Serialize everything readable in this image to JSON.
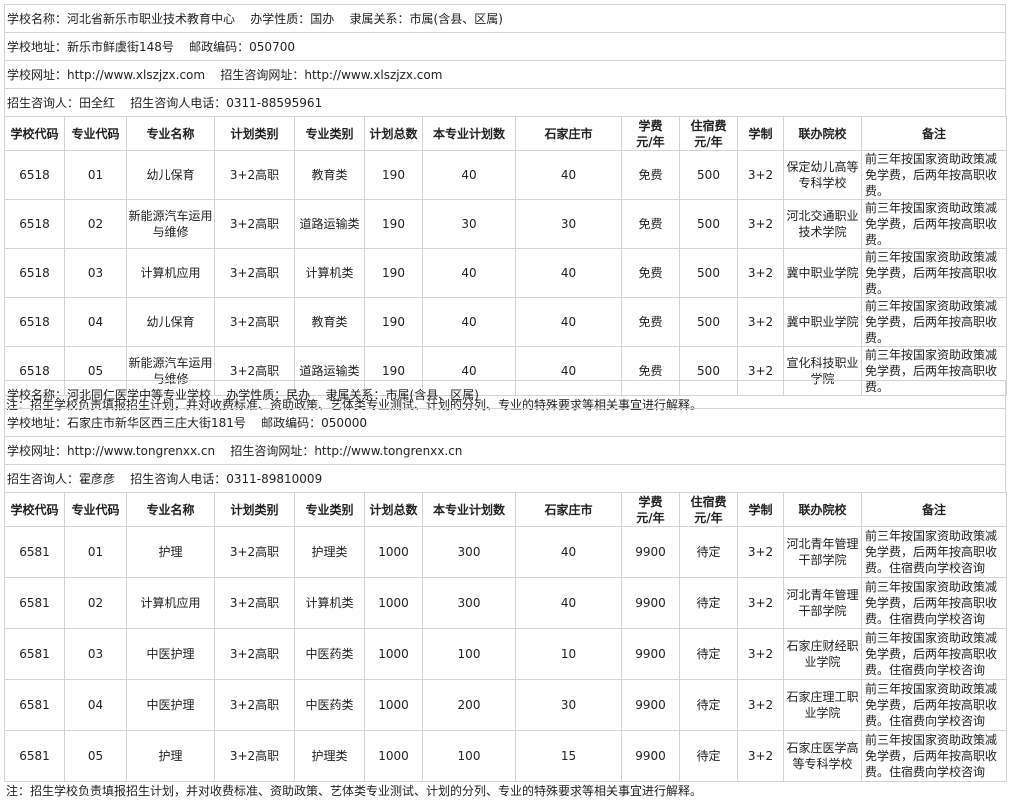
{
  "headers": [
    "学校代码",
    "专业代码",
    "专业名称",
    "计划类别",
    "专业类别",
    "计划总数",
    "本专业计划数",
    "石家庄市",
    "学费元/年",
    "住宿费元/年",
    "学制",
    "联办院校",
    "备注"
  ],
  "header_lines": {
    "tuition": [
      "学费",
      "元/年"
    ],
    "dorm": [
      "住宿费",
      "元/年"
    ]
  },
  "schools": [
    {
      "info": [
        "学校名称：河北省新乐市职业技术教育中心    办学性质：国办    隶属关系：市属(含县、区属)",
        "学校地址：新乐市鲜虞街148号    邮政编码：050700",
        "学校网址：http://www.xlszjzx.com    招生咨询网址：http://www.xlszjzx.com",
        "招生咨询人：田全红    招生咨询人电话：0311-88595961"
      ],
      "rows": [
        {
          "school_code": "6518",
          "major_code": "01",
          "major": "幼儿保育",
          "plan_type": "3+2高职",
          "category": "教育类",
          "total": "190",
          "major_plan": "40",
          "sjz": "40",
          "tuition": "免费",
          "dorm": "500",
          "years": "3+2",
          "partner": "保定幼儿高等专科学校",
          "note": "前三年按国家资助政策减免学费，后两年按高职收费。"
        },
        {
          "school_code": "6518",
          "major_code": "02",
          "major": "新能源汽车运用与维修",
          "plan_type": "3+2高职",
          "category": "道路运输类",
          "total": "190",
          "major_plan": "30",
          "sjz": "30",
          "tuition": "免费",
          "dorm": "500",
          "years": "3+2",
          "partner": "河北交通职业技术学院",
          "note": "前三年按国家资助政策减免学费，后两年按高职收费。"
        },
        {
          "school_code": "6518",
          "major_code": "03",
          "major": "计算机应用",
          "plan_type": "3+2高职",
          "category": "计算机类",
          "total": "190",
          "major_plan": "40",
          "sjz": "40",
          "tuition": "免费",
          "dorm": "500",
          "years": "3+2",
          "partner": "冀中职业学院",
          "note": "前三年按国家资助政策减免学费，后两年按高职收费。"
        },
        {
          "school_code": "6518",
          "major_code": "04",
          "major": "幼儿保育",
          "plan_type": "3+2高职",
          "category": "教育类",
          "total": "190",
          "major_plan": "40",
          "sjz": "40",
          "tuition": "免费",
          "dorm": "500",
          "years": "3+2",
          "partner": "冀中职业学院",
          "note": "前三年按国家资助政策减免学费，后两年按高职收费。"
        },
        {
          "school_code": "6518",
          "major_code": "05",
          "major": "新能源汽车运用与维修",
          "plan_type": "3+2高职",
          "category": "道路运输类",
          "total": "190",
          "major_plan": "40",
          "sjz": "40",
          "tuition": "免费",
          "dorm": "500",
          "years": "3+2",
          "partner": "宣化科技职业学院",
          "note": "前三年按国家资助政策减免学费，后两年按高职收费。"
        }
      ],
      "footnote": "注：招生学校负责填报招生计划，并对收费标准、资助政策、艺体类专业测试、计划的分列、专业的特殊要求等相关事宜进行解释。"
    },
    {
      "info": [
        "学校名称：河北同仁医学中等专业学校    办学性质：民办    隶属关系：市属(含县、区属)",
        "学校地址：石家庄市新华区西三庄大街181号    邮政编码：050000",
        "学校网址：http://www.tongrenxx.cn    招生咨询网址：http://www.tongrenxx.cn",
        "招生咨询人：霍彦彦    招生咨询人电话：0311-89810009"
      ],
      "rows": [
        {
          "school_code": "6581",
          "major_code": "01",
          "major": "护理",
          "plan_type": "3+2高职",
          "category": "护理类",
          "total": "1000",
          "major_plan": "300",
          "sjz": "40",
          "tuition": "9900",
          "dorm": "待定",
          "years": "3+2",
          "partner": "河北青年管理干部学院",
          "note": "前三年按国家资助政策减免学费，后两年按高职收费。住宿费向学校咨询"
        },
        {
          "school_code": "6581",
          "major_code": "02",
          "major": "计算机应用",
          "plan_type": "3+2高职",
          "category": "计算机类",
          "total": "1000",
          "major_plan": "300",
          "sjz": "40",
          "tuition": "9900",
          "dorm": "待定",
          "years": "3+2",
          "partner": "河北青年管理干部学院",
          "note": "前三年按国家资助政策减免学费，后两年按高职收费。住宿费向学校咨询"
        },
        {
          "school_code": "6581",
          "major_code": "03",
          "major": "中医护理",
          "plan_type": "3+2高职",
          "category": "中医药类",
          "total": "1000",
          "major_plan": "100",
          "sjz": "10",
          "tuition": "9900",
          "dorm": "待定",
          "years": "3+2",
          "partner": "石家庄财经职业学院",
          "note": "前三年按国家资助政策减免学费，后两年按高职收费。住宿费向学校咨询"
        },
        {
          "school_code": "6581",
          "major_code": "04",
          "major": "中医护理",
          "plan_type": "3+2高职",
          "category": "中医药类",
          "total": "1000",
          "major_plan": "200",
          "sjz": "30",
          "tuition": "9900",
          "dorm": "待定",
          "years": "3+2",
          "partner": "石家庄理工职业学院",
          "note": "前三年按国家资助政策减免学费，后两年按高职收费。住宿费向学校咨询"
        },
        {
          "school_code": "6581",
          "major_code": "05",
          "major": "护理",
          "plan_type": "3+2高职",
          "category": "护理类",
          "total": "1000",
          "major_plan": "100",
          "sjz": "15",
          "tuition": "9900",
          "dorm": "待定",
          "years": "3+2",
          "partner": "石家庄医学高等专科学校",
          "note": "前三年按国家资助政策减免学费，后两年按高职收费。住宿费向学校咨询"
        }
      ],
      "footnote": "注：招生学校负责填报招生计划，并对收费标准、资助政策、艺体类专业测试、计划的分列、专业的特殊要求等相关事宜进行解释。"
    }
  ]
}
